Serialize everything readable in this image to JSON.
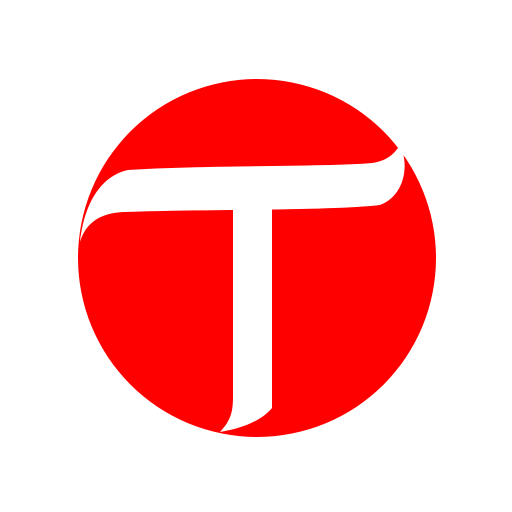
{
  "logo": {
    "glyph": "T",
    "mark_name": "t-circle-logo",
    "colors": {
      "circle": "#ff0000",
      "letter": "#ffffff",
      "background": "#ffffff"
    }
  }
}
